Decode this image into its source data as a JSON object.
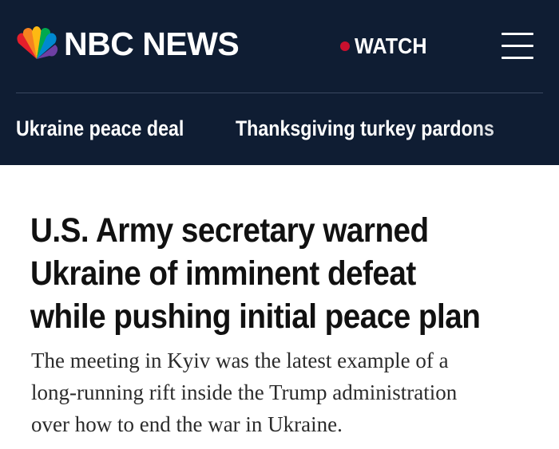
{
  "header": {
    "brand": "NBC NEWS",
    "watch_label": "WATCH",
    "colors": {
      "background": "#0f1d33",
      "live_dot": "#c8102e"
    },
    "icons": {
      "logo": "nbc-peacock-icon",
      "menu": "hamburger-menu-icon"
    }
  },
  "trending": {
    "items": [
      {
        "label": "Ukraine peace deal"
      },
      {
        "label": "Thanksgiving turkey pardons"
      }
    ]
  },
  "article": {
    "headline": "U.S. Army secretary warned\nUkraine of imminent defeat\nwhile pushing initial peace plan",
    "dek": "The meeting in Kyiv was the latest example of a\nlong-running rift inside the Trump administration\nover how to end the war in Ukraine."
  }
}
